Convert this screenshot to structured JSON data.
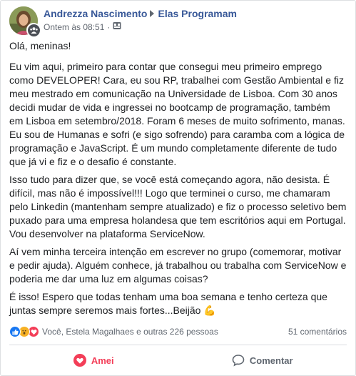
{
  "post": {
    "author": "Andrezza Nascimento",
    "group": "Elas Programam",
    "timestamp": "Ontem às 08:51",
    "dot": "·",
    "privacy_icon": "group-privacy-icon",
    "paragraphs": [
      "Olá, meninas!",
      "Eu vim aqui, primeiro para contar que consegui meu primeiro emprego como DEVELOPER! Cara, eu sou RP, trabalhei com Gestão Ambiental e fiz meu mestrado em comunicação na Universidade de Lisboa. Com 30 anos decidi mudar de vida e ingressei no bootcamp de programação, também em Lisboa em setembro/2018. Foram 6 meses de muito sofrimento, manas. Eu sou de Humanas e sofri (e sigo sofrendo) para caramba com a lógica de programação e JavaScript. É um mundo completamente diferente de tudo que já vi e fiz e o desafio é constante.",
      "Isso tudo para dizer que, se você está começando agora, não desista. É difícil, mas não é impossível!!! Logo que terminei o curso, me chamaram pelo Linkedin (mantenham sempre atualizado) e fiz o processo seletivo bem puxado para uma empresa holandesa que tem escritórios aqui em Portugal. Vou desenvolver na plataforma ServiceNow.",
      "Aí vem minha terceira intenção em escrever no grupo (comemorar, motivar e pedir ajuda). Alguém conhece, já trabalhou ou trabalha com ServiceNow e poderia me dar uma luz em algumas coisas?",
      "É isso! Espero que todas tenham uma boa semana e tenho certeza que juntas sempre seremos mais fortes...Beijão 💪"
    ]
  },
  "stats": {
    "reactions_text": "Você, Estela Magalhaes e outras 226 pessoas",
    "comments_text": "51 comentários",
    "reaction_icons": [
      "like-icon",
      "wow-icon",
      "love-icon"
    ]
  },
  "actions": {
    "love_label": "Amei",
    "comment_label": "Comentar"
  },
  "colors": {
    "link": "#385898",
    "love": "#f33e58",
    "like": "#1877f2",
    "wow": "#f7b125",
    "muted": "#606770"
  }
}
